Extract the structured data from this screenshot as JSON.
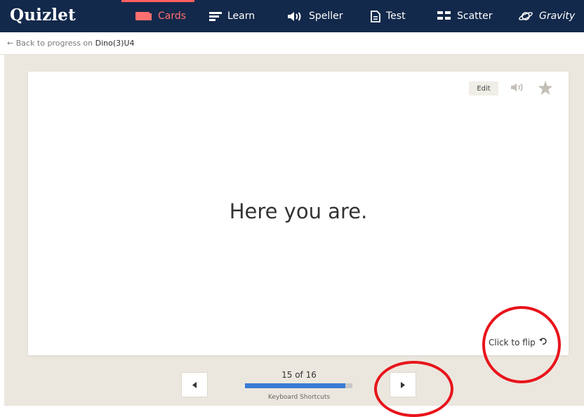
{
  "header": {
    "logo": "Quizlet",
    "nav": [
      {
        "label": "Cards",
        "icon": "cards-icon",
        "active": true
      },
      {
        "label": "Learn",
        "icon": "learn-icon",
        "active": false
      },
      {
        "label": "Speller",
        "icon": "speaker-icon",
        "active": false
      },
      {
        "label": "Test",
        "icon": "document-icon",
        "active": false
      },
      {
        "label": "Scatter",
        "icon": "scatter-grid-icon",
        "active": false
      },
      {
        "label": "Gravity",
        "icon": "planet-icon",
        "active": false
      }
    ],
    "active_color": "#ff6f6f",
    "bar_color": "#13294b"
  },
  "subnav": {
    "back_prefix": "← Back to progress on ",
    "set_name": "Dino(3)U4"
  },
  "card": {
    "edit_label": "Edit",
    "term": "Here you are.",
    "flip_label": "Click to flip"
  },
  "controls": {
    "counter": "15 of 16",
    "progress": 0.9375,
    "shortcuts_label": "Keyboard Shortcuts",
    "progress_color": "#3b7bd4"
  },
  "annotations": {
    "circle_color": "#e8141b"
  }
}
